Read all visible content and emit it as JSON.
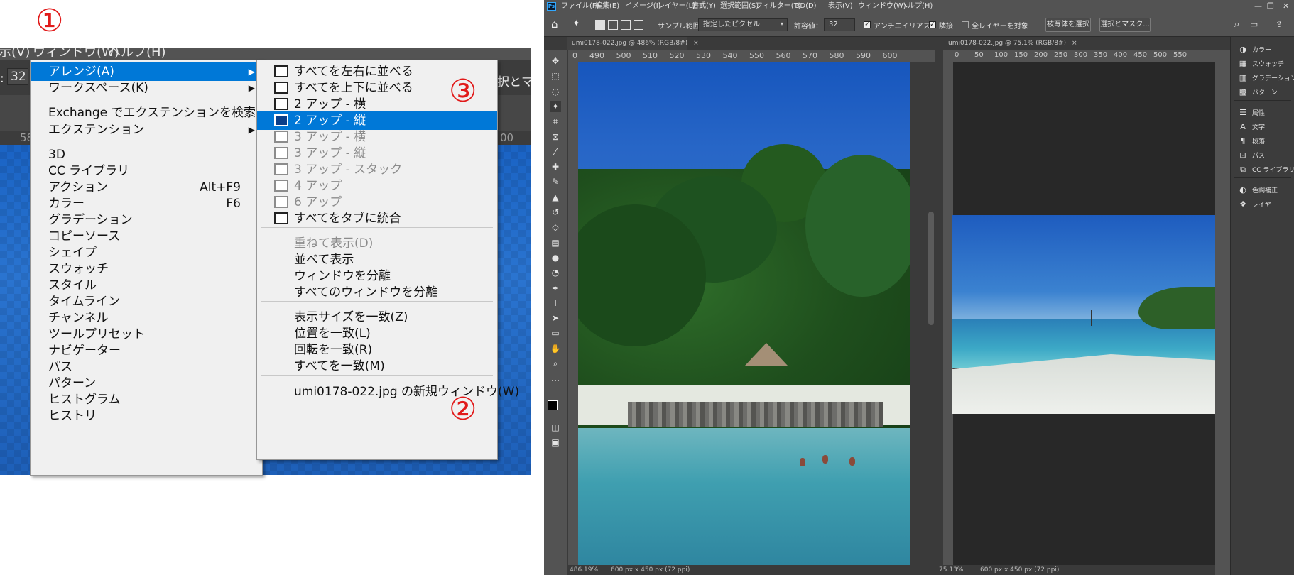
{
  "annotations": {
    "n1": "①",
    "n2": "②",
    "n3": "③"
  },
  "zoom_capture": {
    "menubar": {
      "prefix": "示(V)",
      "window": "ウィンドウ(W)",
      "help": "ヘルプ(H)"
    },
    "optbar_value": "32",
    "optbar_label": ":",
    "ruler_left": "58",
    "ruler_right": "00",
    "right_snip": "択とマス",
    "window_menu": [
      {
        "label": "アレンジ(A)",
        "submenu": true,
        "selected": true
      },
      {
        "label": "ワークスペース(K)",
        "submenu": true
      },
      {
        "label": "Exchange でエクステンションを検索..."
      },
      {
        "label": "エクステンション",
        "submenu": true
      },
      {
        "label": "3D"
      },
      {
        "label": "CC ライブラリ"
      },
      {
        "label": "アクション",
        "shortcut": "Alt+F9"
      },
      {
        "label": "カラー",
        "shortcut": "F6"
      },
      {
        "label": "グラデーション"
      },
      {
        "label": "コピーソース"
      },
      {
        "label": "シェイプ"
      },
      {
        "label": "スウォッチ"
      },
      {
        "label": "スタイル"
      },
      {
        "label": "タイムライン"
      },
      {
        "label": "チャンネル"
      },
      {
        "label": "ツールプリセット"
      },
      {
        "label": "ナビゲーター"
      },
      {
        "label": "パス"
      },
      {
        "label": "パターン"
      },
      {
        "label": "ヒストグラム"
      },
      {
        "label": "ヒストリ"
      }
    ],
    "arrange_menu": [
      {
        "label": "すべてを左右に並べる",
        "icon": "tile-vertical-icon"
      },
      {
        "label": "すべてを上下に並べる",
        "icon": "tile-horizontal-icon"
      },
      {
        "label": "2 アップ - 横",
        "icon": "2up-horizontal-icon"
      },
      {
        "label": "2 アップ - 縦",
        "icon": "2up-vertical-icon",
        "selected": true
      },
      {
        "label": "3 アップ - 横",
        "icon": "3up-horizontal-icon",
        "disabled": true
      },
      {
        "label": "3 アップ - 縦",
        "icon": "3up-vertical-icon",
        "disabled": true
      },
      {
        "label": "3 アップ - スタック",
        "icon": "3up-stack-icon",
        "disabled": true
      },
      {
        "label": "4 アップ",
        "icon": "4up-icon",
        "disabled": true
      },
      {
        "label": "6 アップ",
        "icon": "6up-icon",
        "disabled": true
      },
      {
        "label": "すべてをタブに統合",
        "icon": "consolidate-tabs-icon"
      },
      {
        "label": "重ねて表示(D)",
        "disabled": true
      },
      {
        "label": "並べて表示"
      },
      {
        "label": "ウィンドウを分離"
      },
      {
        "label": "すべてのウィンドウを分離"
      },
      {
        "label": "表示サイズを一致(Z)"
      },
      {
        "label": "位置を一致(L)"
      },
      {
        "label": "回転を一致(R)"
      },
      {
        "label": "すべてを一致(M)"
      },
      {
        "label": "umi0178-022.jpg の新規ウィンドウ(W)"
      }
    ]
  },
  "photoshop": {
    "logo": "Ps",
    "menu": [
      "ファイル(F)",
      "編集(E)",
      "イメージ(I)",
      "レイヤー(L)",
      "書式(Y)",
      "選択範囲(S)",
      "フィルター(T)",
      "3D(D)",
      "表示(V)",
      "ウィンドウ(W)",
      "ヘルプ(H)"
    ],
    "window_controls": {
      "minimize": "—",
      "restore": "❐",
      "close": "✕"
    },
    "options": {
      "sample_label": "サンプル範囲：",
      "sample_value": "指定したピクセル",
      "tolerance_label": "許容値：",
      "tolerance_value": "32",
      "antialias": "アンチエイリアス",
      "contiguous": "隣接",
      "all_layers": "全レイヤーを対象",
      "select_subject": "被写体を選択",
      "select_mask": "選択とマスク..."
    },
    "doc1": {
      "tab": "umi0178-022.jpg @ 486% (RGB/8#)",
      "ruler": [
        "0",
        "490",
        "500",
        "510",
        "520",
        "530",
        "540",
        "550",
        "560",
        "570",
        "580",
        "590",
        "600"
      ],
      "zoom": "486.19%",
      "size": "600 px x 450 px (72 ppi)"
    },
    "doc2": {
      "tab": "umi0178-022.jpg @ 75.1% (RGB/8#)",
      "ruler": [
        "0",
        "50",
        "100",
        "150",
        "200",
        "250",
        "300",
        "350",
        "400",
        "450",
        "500",
        "550"
      ],
      "zoom": "75.13%",
      "size": "600 px x 450 px (72 ppi)"
    },
    "panels": [
      {
        "label": "カラー",
        "icon": "color-icon"
      },
      {
        "label": "スウォッチ",
        "icon": "swatches-icon"
      },
      {
        "label": "グラデーション",
        "icon": "gradient-icon"
      },
      {
        "label": "パターン",
        "icon": "pattern-icon"
      },
      {
        "label": "属性",
        "icon": "properties-icon"
      },
      {
        "label": "文字",
        "icon": "character-icon"
      },
      {
        "label": "段落",
        "icon": "paragraph-icon"
      },
      {
        "label": "パス",
        "icon": "paths-icon"
      },
      {
        "label": "CC ライブラリ",
        "icon": "libraries-icon"
      },
      {
        "label": "色調補正",
        "icon": "adjustments-icon"
      },
      {
        "label": "レイヤー",
        "icon": "layers-icon"
      }
    ],
    "colors": {
      "accent": "#0078d7",
      "annotation": "#e11a1a",
      "ps_bg": "#535353",
      "ps_dark": "#282828"
    }
  }
}
